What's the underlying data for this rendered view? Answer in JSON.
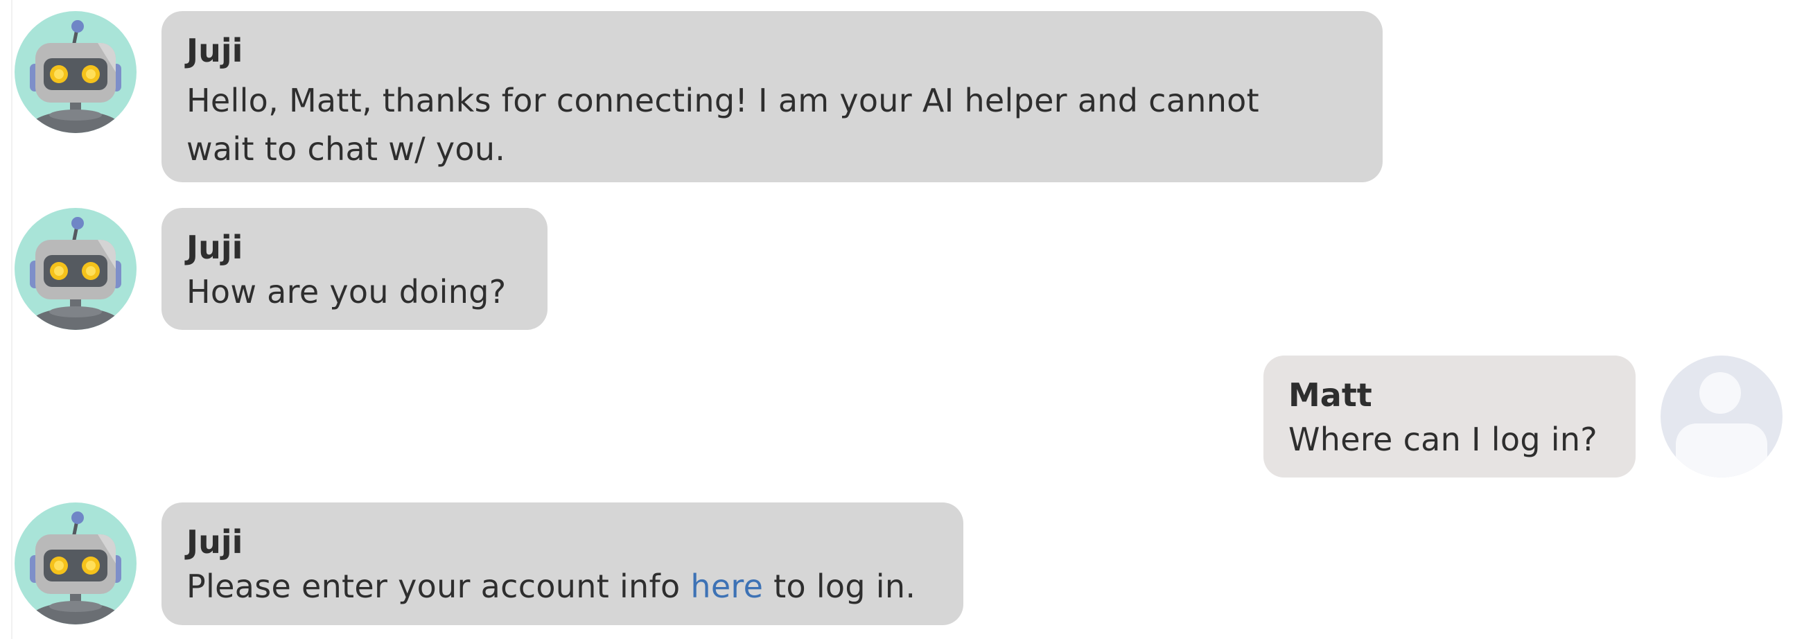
{
  "messages": [
    {
      "sender": "Juji",
      "role": "bot",
      "lines": [
        "Hello, Matt, thanks for connecting! I am your AI helper and cannot",
        "wait to chat w/ you."
      ]
    },
    {
      "sender": "Juji",
      "role": "bot",
      "lines": [
        "How are you doing?"
      ]
    },
    {
      "sender": "Matt",
      "role": "user",
      "lines": [
        "Where can I log in?"
      ]
    },
    {
      "sender": "Juji",
      "role": "bot",
      "text_before": "Please enter your account info ",
      "link_text": "here",
      "text_after": " to log in."
    }
  ],
  "icons": {
    "bot_avatar": "robot-avatar-icon",
    "user_avatar": "person-silhouette-icon"
  },
  "colors": {
    "bot_avatar_bg": "#a9e4d8",
    "bot_bubble": "#d6d6d6",
    "user_bubble": "#e6e3e2",
    "user_avatar_bg": "#e4e7ef",
    "link": "#3d72b5",
    "text": "#2e2e2e"
  }
}
